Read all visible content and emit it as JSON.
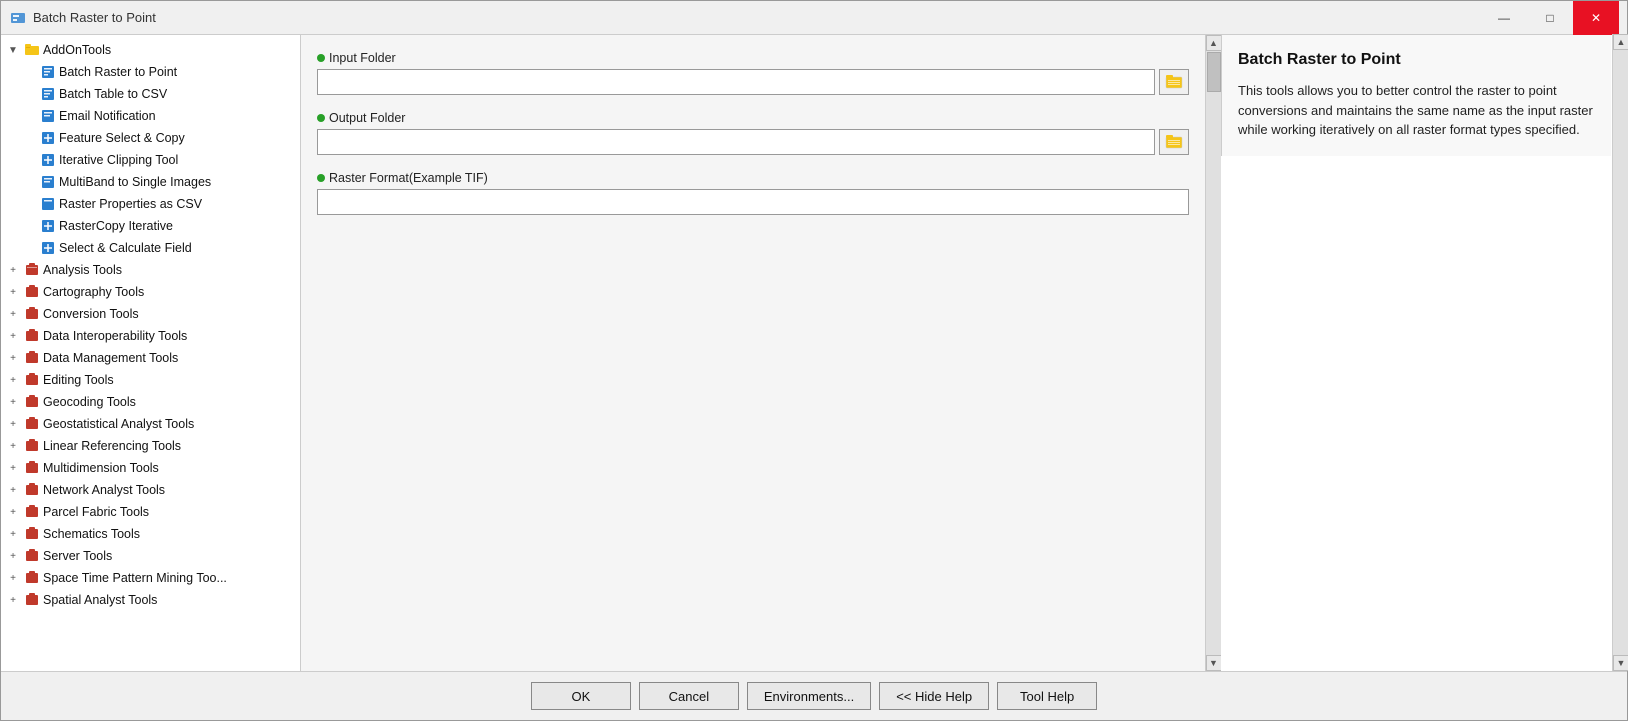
{
  "titleBar": {
    "title": "Batch Raster to Point",
    "minBtn": "—",
    "maxBtn": "□",
    "closeBtn": "✕"
  },
  "sidebar": {
    "addOnTools": {
      "label": "AddOnTools",
      "expanded": true,
      "children": [
        {
          "label": "Batch Raster to Point",
          "type": "tool"
        },
        {
          "label": "Batch Table to CSV",
          "type": "tool"
        },
        {
          "label": "Email Notification",
          "type": "tool"
        },
        {
          "label": "Feature Select & Copy",
          "type": "tool-plus"
        },
        {
          "label": "Iterative Clipping Tool",
          "type": "tool-plus"
        },
        {
          "label": "MultiBand to Single Images",
          "type": "tool"
        },
        {
          "label": "Raster Properties as CSV",
          "type": "tool"
        },
        {
          "label": "RasterCopy Iterative",
          "type": "tool-plus"
        },
        {
          "label": "Select & Calculate Field",
          "type": "tool-plus"
        }
      ]
    },
    "toolboxes": [
      {
        "label": "Analysis Tools",
        "expanded": false
      },
      {
        "label": "Cartography Tools",
        "expanded": false
      },
      {
        "label": "Conversion Tools",
        "expanded": false
      },
      {
        "label": "Data Interoperability Tools",
        "expanded": false
      },
      {
        "label": "Data Management Tools",
        "expanded": false
      },
      {
        "label": "Editing Tools",
        "expanded": false
      },
      {
        "label": "Geocoding Tools",
        "expanded": false
      },
      {
        "label": "Geostatistical Analyst Tools",
        "expanded": false
      },
      {
        "label": "Linear Referencing Tools",
        "expanded": false
      },
      {
        "label": "Multidimension Tools",
        "expanded": false
      },
      {
        "label": "Network Analyst Tools",
        "expanded": false
      },
      {
        "label": "Parcel Fabric Tools",
        "expanded": false
      },
      {
        "label": "Schematics Tools",
        "expanded": false
      },
      {
        "label": "Server Tools",
        "expanded": false
      },
      {
        "label": "Space Time Pattern Mining Too...",
        "expanded": false
      },
      {
        "label": "Spatial Analyst Tools",
        "expanded": false
      }
    ]
  },
  "form": {
    "fields": [
      {
        "id": "inputFolder",
        "label": "Input Folder",
        "required": true,
        "hasBrowse": true,
        "value": ""
      },
      {
        "id": "outputFolder",
        "label": "Output Folder",
        "required": true,
        "hasBrowse": true,
        "value": ""
      },
      {
        "id": "rasterFormat",
        "label": "Raster Format(Example TIF)",
        "required": true,
        "hasBrowse": false,
        "value": ""
      }
    ]
  },
  "help": {
    "title": "Batch Raster to Point",
    "description": "This tools allows you to better control the raster to point conversions and maintains the same name as the input raster while working iteratively on all raster format types specified."
  },
  "buttons": [
    {
      "id": "ok",
      "label": "OK"
    },
    {
      "id": "cancel",
      "label": "Cancel"
    },
    {
      "id": "environments",
      "label": "Environments..."
    },
    {
      "id": "hideHelp",
      "label": "<< Hide Help"
    },
    {
      "id": "toolHelp",
      "label": "Tool Help"
    }
  ]
}
